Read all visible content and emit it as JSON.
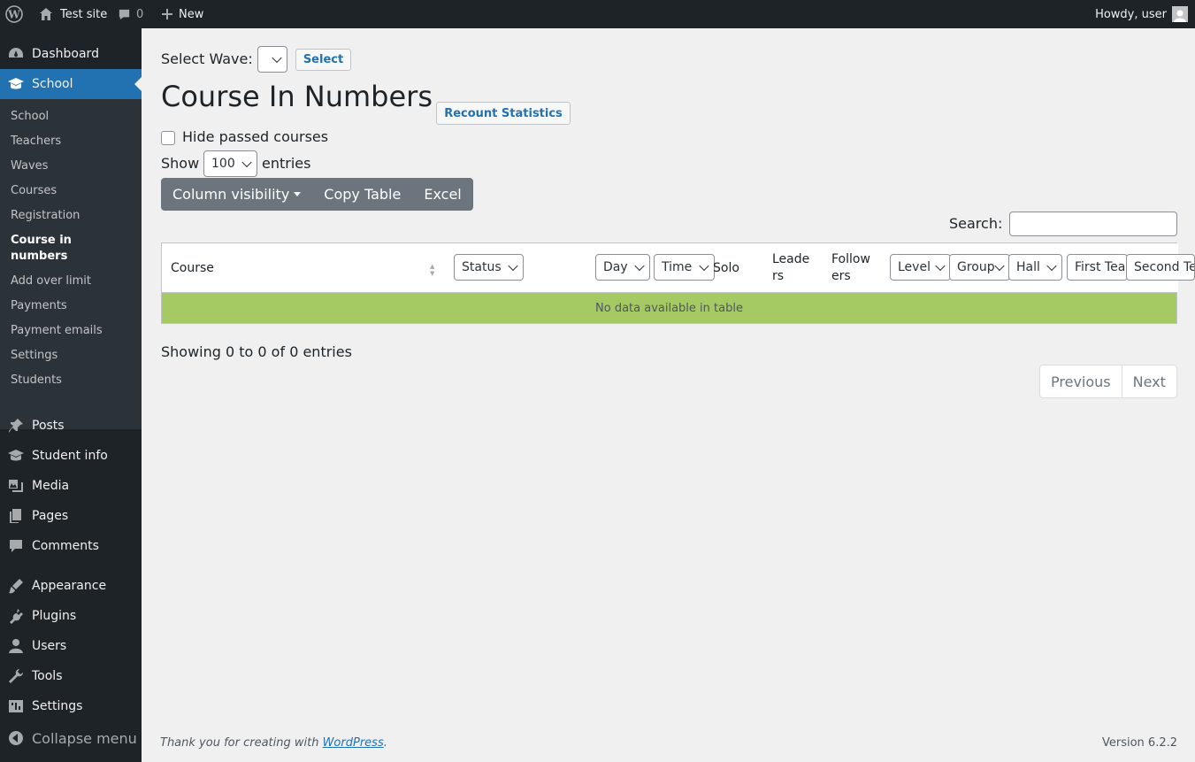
{
  "adminbar": {
    "site_name": "Test site",
    "comments_count": "0",
    "new_label": "New",
    "howdy": "Howdy, user"
  },
  "sidebar": {
    "top": [
      {
        "label": "Dashboard",
        "icon": "dashboard-icon"
      },
      {
        "label": "School",
        "icon": "school-icon"
      }
    ],
    "submenu": [
      "School",
      "Teachers",
      "Waves",
      "Courses",
      "Registration",
      "Course in numbers",
      "Add over limit",
      "Payments",
      "Payment emails",
      "Settings",
      "Students"
    ],
    "bottom": [
      {
        "label": "Posts",
        "icon": "pin-icon"
      },
      {
        "label": "Student info",
        "icon": "school-icon"
      },
      {
        "label": "Media",
        "icon": "media-icon"
      },
      {
        "label": "Pages",
        "icon": "pages-icon"
      },
      {
        "label": "Comments",
        "icon": "comment-icon"
      },
      {
        "label": "Appearance",
        "icon": "brush-icon"
      },
      {
        "label": "Plugins",
        "icon": "plug-icon"
      },
      {
        "label": "Users",
        "icon": "user-icon"
      },
      {
        "label": "Tools",
        "icon": "wrench-icon"
      },
      {
        "label": "Settings",
        "icon": "settings-icon"
      }
    ],
    "collapse_label": "Collapse menu"
  },
  "main": {
    "select_wave_label": "Select Wave:",
    "select_button": "Select",
    "title": "Course In Numbers",
    "recount_button": "Recount Statistics",
    "hide_passed_label": "Hide passed courses",
    "show_label": "Show",
    "entries_value": "100",
    "entries_label": "entries",
    "column_visibility": "Column visibility",
    "copy_table": "Copy Table",
    "excel": "Excel",
    "search_label": "Search:",
    "columns": {
      "course": "Course",
      "status": "Status",
      "day": "Day",
      "time": "Time",
      "solo": "Solo",
      "leaders_1": "Leade",
      "leaders_2": "rs",
      "followers_1": "Follow",
      "followers_2": "ers",
      "level": "Level",
      "group": "Group",
      "hall": "Hall",
      "first_teacher": "First Tea",
      "second_teacher": "Second Te"
    },
    "empty_message": "No data available in table",
    "showing": "Showing 0 to 0 of 0 entries",
    "previous": "Previous",
    "next": "Next"
  },
  "footer": {
    "thank_you": "Thank you for creating with ",
    "wordpress": "WordPress",
    "period": ".",
    "version": "Version 6.2.2"
  },
  "colors": {
    "admin_dark": "#1d2327",
    "submenu_bg": "#2c3338",
    "accent": "#2271b1",
    "empty_row": "#a5c963",
    "button_group": "#6c757d"
  }
}
